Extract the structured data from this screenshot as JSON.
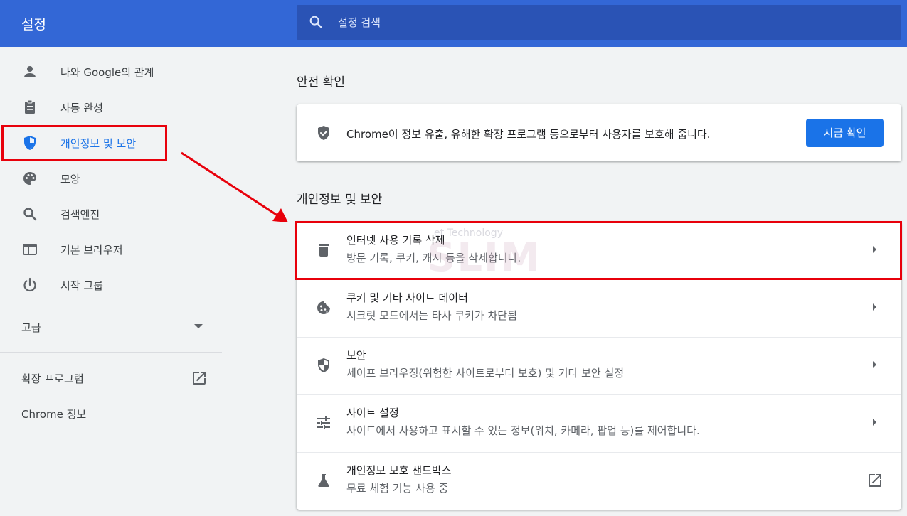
{
  "header": {
    "title": "설정",
    "search_placeholder": "설정 검색"
  },
  "sidebar": {
    "items": [
      {
        "label": "나와 Google의 관계",
        "icon": "person-icon"
      },
      {
        "label": "자동 완성",
        "icon": "clipboard-icon"
      },
      {
        "label": "개인정보 및 보안",
        "icon": "shield-icon",
        "active": true
      },
      {
        "label": "모양",
        "icon": "palette-icon"
      },
      {
        "label": "검색엔진",
        "icon": "search-icon"
      },
      {
        "label": "기본 브라우저",
        "icon": "browser-icon"
      },
      {
        "label": "시작 그룹",
        "icon": "power-icon"
      }
    ],
    "advanced_label": "고급",
    "extensions_label": "확장 프로그램",
    "about_label": "Chrome 정보"
  },
  "safety": {
    "section_title": "안전 확인",
    "description": "Chrome이 정보 유출, 유해한 확장 프로그램 등으로부터 사용자를 보호해 줍니다.",
    "button_label": "지금 확인"
  },
  "privacy": {
    "section_title": "개인정보 및 보안",
    "rows": [
      {
        "title": "인터넷 사용 기록 삭제",
        "subtitle": "방문 기록, 쿠키, 캐시 등을 삭제합니다.",
        "icon": "trash-icon"
      },
      {
        "title": "쿠키 및 기타 사이트 데이터",
        "subtitle": "시크릿 모드에서는 타사 쿠키가 차단됨",
        "icon": "cookie-icon"
      },
      {
        "title": "보안",
        "subtitle": "세이프 브라우징(위험한 사이트로부터 보호) 및 기타 보안 설정",
        "icon": "shield-icon"
      },
      {
        "title": "사이트 설정",
        "subtitle": "사이트에서 사용하고 표시할 수 있는 정보(위치, 카메라, 팝업 등)를 제어합니다.",
        "icon": "sliders-icon"
      },
      {
        "title": "개인정보 보호 샌드박스",
        "subtitle": "무료 체험 기능 사용 중",
        "icon": "flask-icon"
      }
    ]
  },
  "watermark": {
    "small": "et Technology",
    "big": "SLIM"
  },
  "colors": {
    "header_bg": "#3367d6",
    "search_bg": "#2a53b5",
    "accent": "#1a73e8",
    "highlight": "#e8000b"
  }
}
